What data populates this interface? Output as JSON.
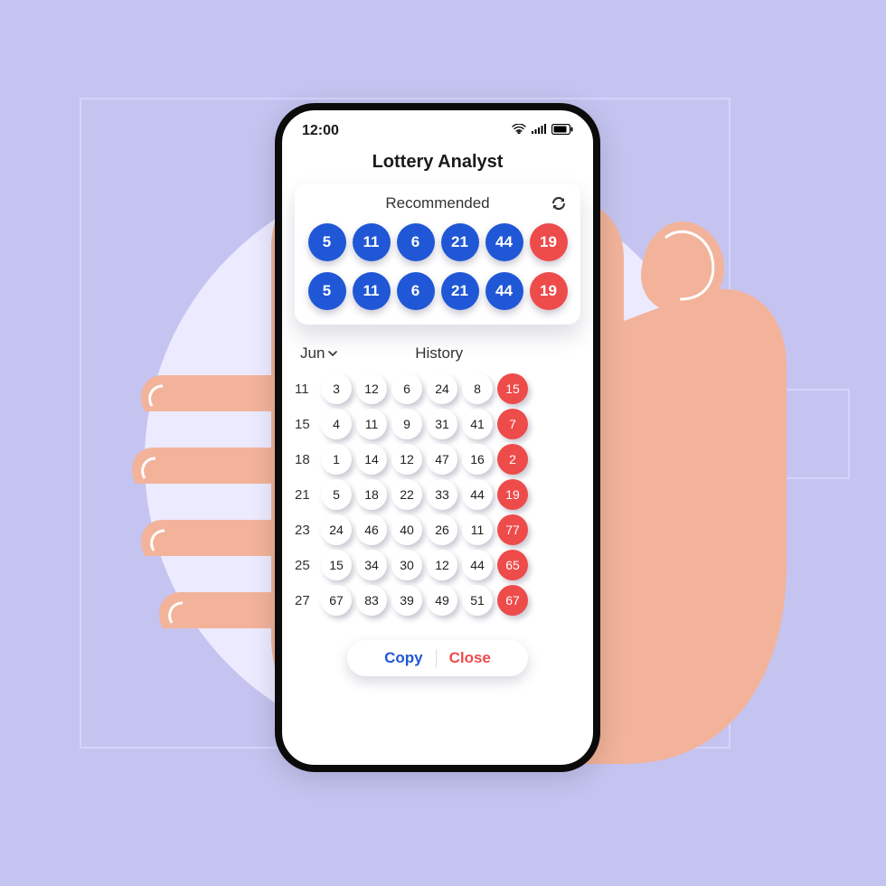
{
  "statusbar": {
    "time": "12:00"
  },
  "app": {
    "title": "Lottery Analyst"
  },
  "recommended": {
    "title": "Recommended",
    "rows": [
      {
        "balls": [
          "5",
          "11",
          "6",
          "21",
          "44",
          "19"
        ]
      },
      {
        "balls": [
          "5",
          "11",
          "6",
          "21",
          "44",
          "19"
        ]
      }
    ]
  },
  "history": {
    "month": "Jun",
    "title": "History",
    "rows": [
      {
        "day": "11",
        "nums": [
          "3",
          "12",
          "6",
          "24",
          "8"
        ],
        "bonus": "15"
      },
      {
        "day": "15",
        "nums": [
          "4",
          "11",
          "9",
          "31",
          "41"
        ],
        "bonus": "7"
      },
      {
        "day": "18",
        "nums": [
          "1",
          "14",
          "12",
          "47",
          "16"
        ],
        "bonus": "2"
      },
      {
        "day": "21",
        "nums": [
          "5",
          "18",
          "22",
          "33",
          "44"
        ],
        "bonus": "19"
      },
      {
        "day": "23",
        "nums": [
          "24",
          "46",
          "40",
          "26",
          "11"
        ],
        "bonus": "77"
      },
      {
        "day": "25",
        "nums": [
          "15",
          "34",
          "30",
          "12",
          "44"
        ],
        "bonus": "65"
      },
      {
        "day": "27",
        "nums": [
          "67",
          "83",
          "39",
          "49",
          "51"
        ],
        "bonus": "67"
      }
    ]
  },
  "actions": {
    "copy": "Copy",
    "close": "Close"
  }
}
